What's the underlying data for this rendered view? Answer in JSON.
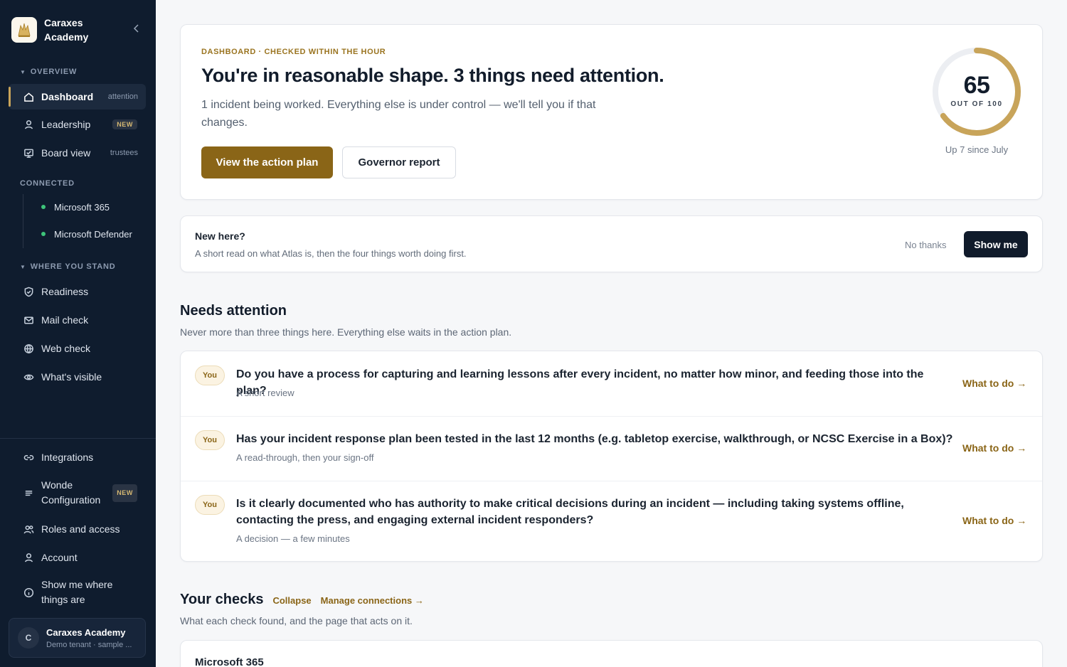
{
  "brand": {
    "name": "Caraxes Academy"
  },
  "sidebar": {
    "overview_label": "OVERVIEW",
    "overview_items": [
      {
        "label": "Dashboard",
        "tag": "attention",
        "icon": "home-icon"
      },
      {
        "label": "Leadership",
        "badge": "NEW",
        "icon": "user-icon"
      },
      {
        "label": "Board view",
        "tag": "trustees",
        "icon": "board-icon"
      }
    ],
    "connected_label": "CONNECTED",
    "connected_items": [
      {
        "label": "Microsoft 365",
        "status_color": "#3ec47a"
      },
      {
        "label": "Microsoft Defender",
        "status_color": "#3ec47a"
      }
    ],
    "stand_label": "WHERE YOU STAND",
    "stand_items": [
      {
        "label": "Readiness",
        "icon": "shield-icon"
      },
      {
        "label": "Mail check",
        "icon": "mail-icon"
      },
      {
        "label": "Web check",
        "icon": "globe-icon"
      },
      {
        "label": "What's visible",
        "icon": "eye-icon"
      }
    ],
    "bottom_items": [
      {
        "label": "Integrations",
        "icon": "link-icon"
      },
      {
        "label": "Wonde Configuration",
        "badge": "NEW",
        "icon": "menu-icon"
      },
      {
        "label": "Roles and access",
        "icon": "users-icon"
      },
      {
        "label": "Account",
        "icon": "user-icon"
      },
      {
        "label": "Show me where things are",
        "icon": "info-icon"
      }
    ],
    "tenant": {
      "initial": "C",
      "name": "Caraxes Academy",
      "sub": "Demo tenant · sample ..."
    }
  },
  "hero": {
    "eyebrow": "DASHBOARD · CHECKED WITHIN THE HOUR",
    "title": "You're in reasonable shape. 3 things need attention.",
    "subtitle": "1 incident being worked. Everything else is under control — we'll tell you if that changes.",
    "primary_label": "View the action plan",
    "secondary_label": "Governor report",
    "score": {
      "value": "65",
      "max": 100,
      "fraction": 0.65,
      "label": "OUT OF 100",
      "trend": "Up 7 since July",
      "color": "#c8a45a",
      "track": "#eceef2"
    }
  },
  "welcome": {
    "title": "New here?",
    "subtitle": "A short read on what Atlas is, then the four things worth doing first.",
    "dismiss_label": "No thanks",
    "cta_label": "Show me"
  },
  "attention": {
    "title": "Needs attention",
    "subtitle": "Never more than three things here. Everything else waits in the action plan.",
    "items": [
      {
        "owner": "You",
        "title": "Do you have a process for capturing and learning lessons after every incident, no matter how minor, and feeding those into the plan?",
        "sub": "A short review",
        "link": "What to do →"
      },
      {
        "owner": "You",
        "title": "Has your incident response plan been tested in the last 12 months (e.g. tabletop exercise, walkthrough, or NCSC Exercise in a Box)?",
        "sub": "A read-through, then your sign-off",
        "link": "What to do →"
      },
      {
        "owner": "You",
        "title": "Is it clearly documented who has authority to make critical decisions during an incident — including taking systems offline, contacting the press, and engaging external incident responders?",
        "sub": "A decision — a few minutes",
        "link": "What to do →"
      }
    ]
  },
  "checks": {
    "title": "Your checks",
    "collapse_label": "Collapse",
    "manage_label": "Manage connections →",
    "subtitle": "What each check found, and the page that acts on it.",
    "first_card": "Microsoft 365"
  },
  "colors": {
    "sidebar_bg": "#0f1c2e",
    "accent": "#8a6517",
    "gold": "#c8a45a"
  }
}
